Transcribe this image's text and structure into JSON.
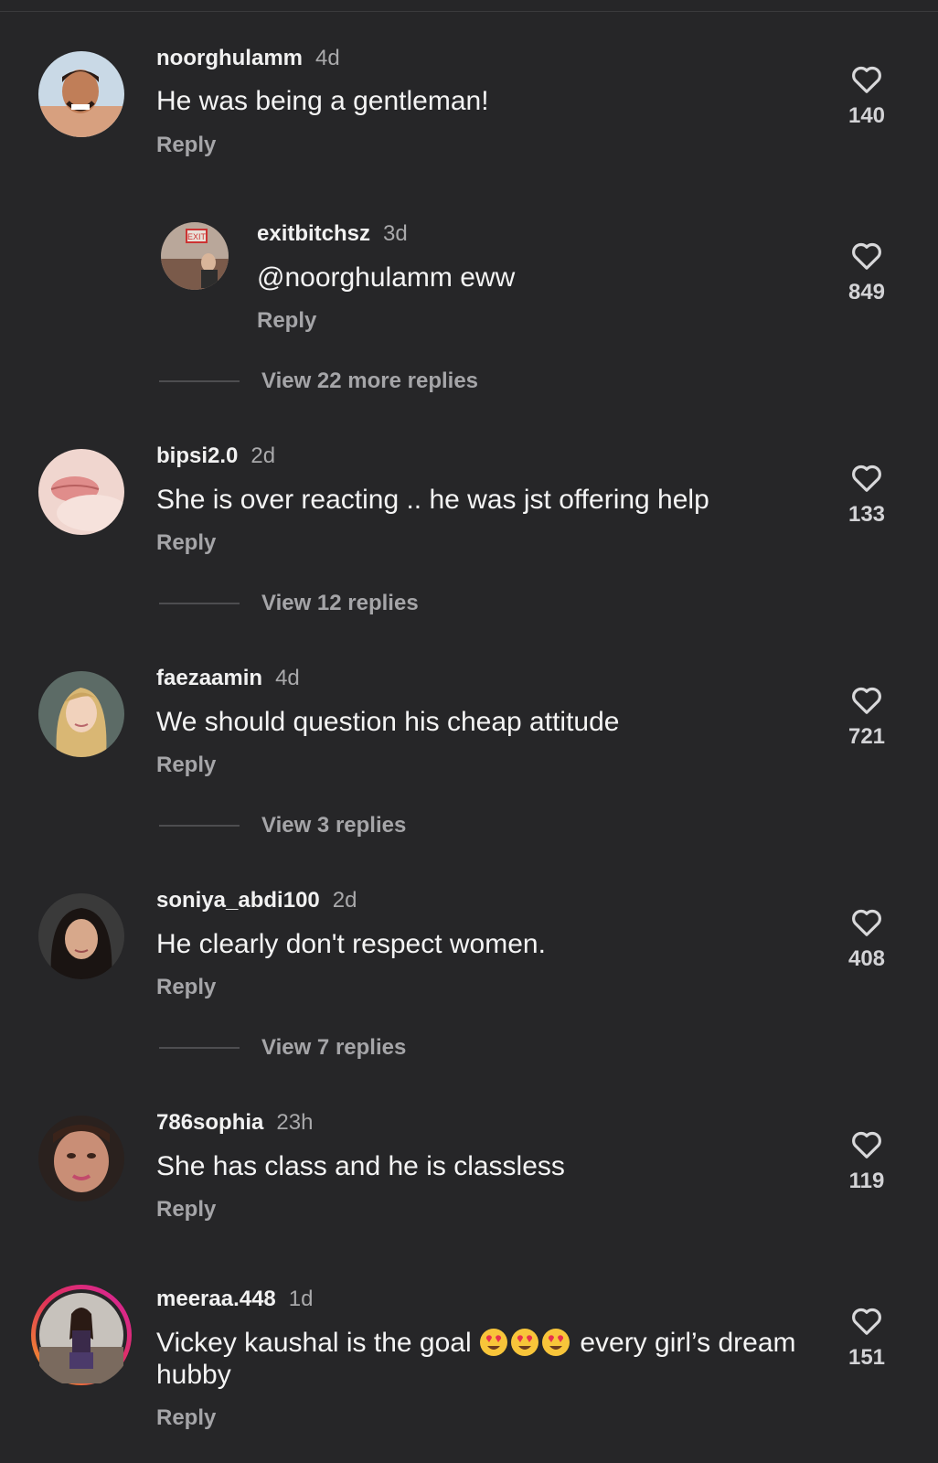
{
  "comments": [
    {
      "username": "noorghulamm",
      "time": "4d",
      "text": "He was being a gentleman!",
      "reply_label": "Reply",
      "likes": "140",
      "avatar_icon": "avatar-photo-man"
    },
    {
      "username": "exitbitchsz",
      "time": "3d",
      "text": "@noorghulamm eww",
      "reply_label": "Reply",
      "likes": "849",
      "avatar_icon": "avatar-photo-exit-sign",
      "view_more": "View 22 more replies"
    },
    {
      "username": "bipsi2.0",
      "time": "2d",
      "text": "She is over reacting .. he was jst offering help",
      "reply_label": "Reply",
      "likes": "133",
      "avatar_icon": "avatar-photo-lips",
      "view_more": "View 12 replies"
    },
    {
      "username": "faezaamin",
      "time": "4d",
      "text": "We should question his cheap attitude",
      "reply_label": "Reply",
      "likes": "721",
      "avatar_icon": "avatar-photo-woman-blonde",
      "view_more": "View 3 replies"
    },
    {
      "username": "soniya_abdi100",
      "time": "2d",
      "text": "He clearly don't respect women.",
      "reply_label": "Reply",
      "likes": "408",
      "avatar_icon": "avatar-photo-woman-dark-hair",
      "view_more": "View 7 replies"
    },
    {
      "username": "786sophia",
      "time": "23h",
      "text": "She has class and he is classless",
      "reply_label": "Reply",
      "likes": "119",
      "avatar_icon": "avatar-photo-woman-close"
    },
    {
      "username": "meeraa.448",
      "time": "1d",
      "text_before_emoji": "Vickey kaushal is the goal ",
      "text_after_emoji": " every girl’s dream hubby",
      "emoji_icon": "heart-eyes-emoji",
      "reply_label": "Reply",
      "likes": "151",
      "avatar_icon": "avatar-photo-woman-story-ring"
    }
  ],
  "colors": {
    "background": "#262628",
    "text": "#f4f4f4",
    "muted": "#a5a5a8",
    "story_ring_start": "#f5a623",
    "story_ring_end": "#d6249f"
  }
}
